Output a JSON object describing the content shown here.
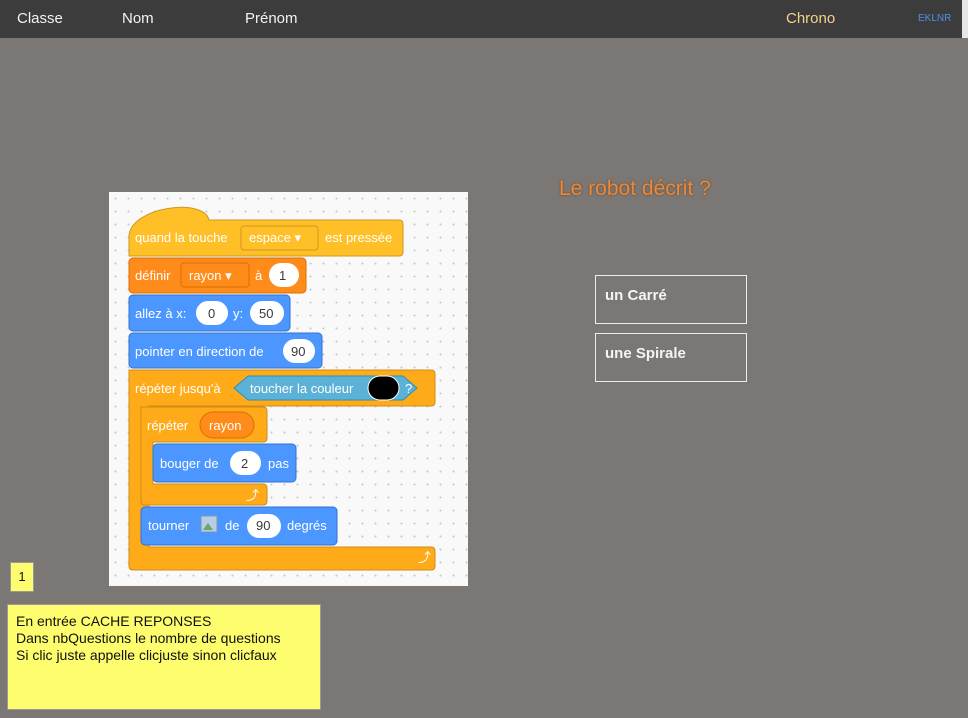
{
  "topbar": {
    "classe": "Classe",
    "nom": "Nom",
    "prenom": "Prénom",
    "chrono": "Chrono",
    "code": "EKLNR"
  },
  "question": "Le robot décrit ?",
  "answers": [
    {
      "label": "un Carré"
    },
    {
      "label": "une Spirale"
    }
  ],
  "counter": "1",
  "note": {
    "lines": [
      "En entrée CACHE REPONSES",
      "Dans nbQuestions le nombre de questions",
      "Si clic juste appelle clicjuste sinon clicfaux"
    ]
  },
  "script": {
    "when_key": "quand la touche",
    "key": "espace ▾",
    "pressed": "est pressée",
    "set": "définir",
    "var": "rayon ▾",
    "to": "à",
    "set_value": "1",
    "goto": "allez à x:",
    "x": "0",
    "y_label": "y:",
    "y": "50",
    "point": "pointer en direction de",
    "direction": "90",
    "repeat_until": "répéter jusqu'à",
    "touching_color": "toucher la couleur",
    "question_mark": "?",
    "repeat": "répéter",
    "repeat_var": "rayon",
    "move": "bouger de",
    "move_value": "2",
    "steps": "pas",
    "turn": "tourner",
    "of": "de",
    "degrees_value": "90",
    "degrees": "degrés"
  },
  "colors": {
    "events": "#ffbf26",
    "variables": "#ff8c1a",
    "motion": "#4c97ff",
    "control": "#ffab19",
    "sensing": "#5cb1d6",
    "question_text": "#e8893c",
    "chrono": "#f5d18a"
  }
}
